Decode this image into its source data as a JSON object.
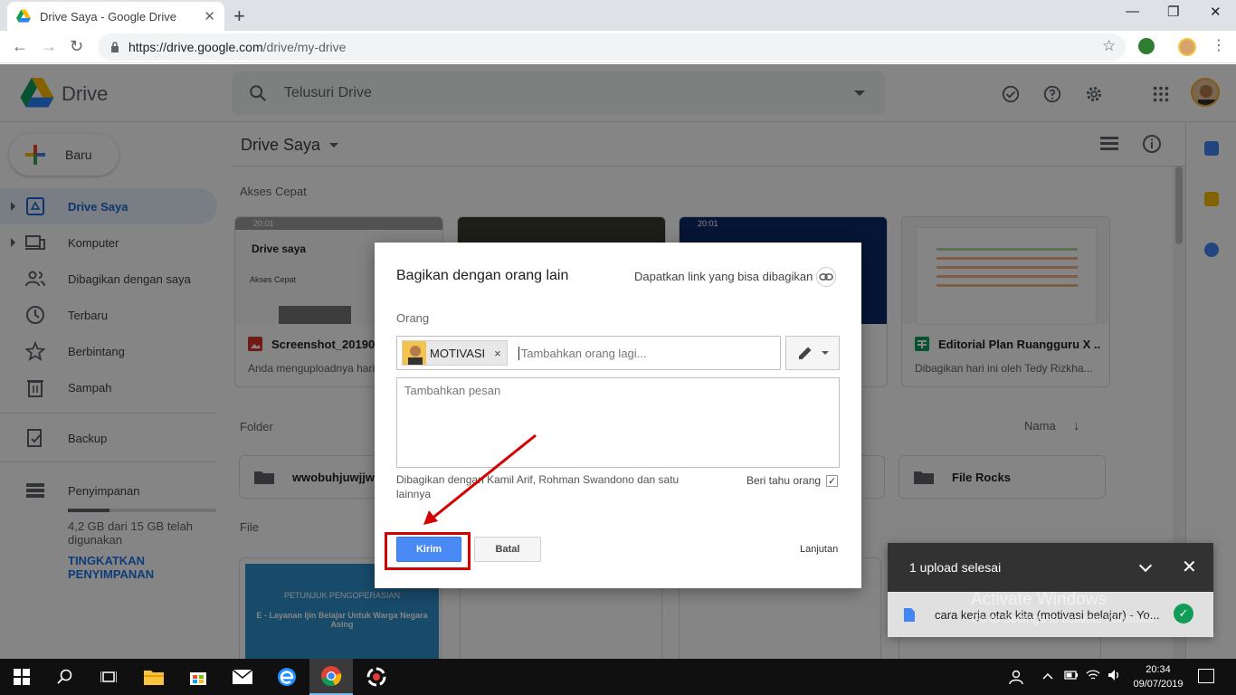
{
  "browser": {
    "tab_title": "Drive Saya - Google Drive",
    "tab_close": "✕",
    "new_tab": "+",
    "url_domain": "https://drive.google.com",
    "url_path": "/drive/my-drive",
    "win_minimize": "—",
    "win_restore": "❐",
    "win_close": "✕",
    "back": "←",
    "forward": "→",
    "reload": "↻",
    "bookmark_star": "☆",
    "menu": "⋮"
  },
  "drive": {
    "app_name": "Drive",
    "search_placeholder": "Telusuri Drive"
  },
  "sidebar": {
    "new_label": "Baru",
    "items": [
      {
        "label": "Drive Saya",
        "icon": "my-drive-icon"
      },
      {
        "label": "Komputer",
        "icon": "computer-icon"
      },
      {
        "label": "Dibagikan dengan saya",
        "icon": "shared-icon"
      },
      {
        "label": "Terbaru",
        "icon": "clock-icon"
      },
      {
        "label": "Berbintang",
        "icon": "star-icon"
      },
      {
        "label": "Sampah",
        "icon": "trash-icon"
      },
      {
        "label": "Backup",
        "icon": "backup-icon"
      },
      {
        "label": "Penyimpanan",
        "icon": "storage-icon"
      }
    ],
    "storage_text": "4,2 GB dari 15 GB telah digunakan",
    "storage_used_fraction": 0.28,
    "upgrade_label": "TINGKATKAN PENYIMPANAN"
  },
  "main": {
    "title": "Drive Saya",
    "quick_access_label": "Akses Cepat",
    "quick_cards": [
      {
        "name": "Screenshot_20190",
        "sub": "Anda menguploadnya hari",
        "thumb_text": "Drive saya",
        "thumb_sub": "Akses Cepat",
        "thumb_status": "20:01"
      },
      {
        "name": "",
        "sub": ""
      },
      {
        "name": "",
        "sub": "",
        "thumb_status": "20:01"
      },
      {
        "name": "Editorial Plan Ruangguru X ...",
        "sub": "Dibagikan hari ini oleh Tedy Rizkha..."
      }
    ],
    "folder_label": "Folder",
    "sort_label": "Nama",
    "folders": [
      {
        "name": "wwobuhjuwjjwik"
      },
      {
        "name": "File Rocks"
      }
    ],
    "file_label": "File",
    "file_thumb_title": "PETUNJUK PENGOPERASIAN",
    "file_thumb_sub": "E - Layanan Ijin Belajar Untuk Warga Negara Asing"
  },
  "dialog": {
    "title": "Bagikan dengan orang lain",
    "get_link": "Dapatkan link yang bisa dibagikan",
    "people_label": "Orang",
    "chip_name": "MOTIVASI",
    "chip_remove": "×",
    "people_placeholder": "Tambahkan orang lagi...",
    "message_placeholder": "Tambahkan pesan",
    "shared_with": "Dibagikan dengan Kamil Arif, Rohman Swandono dan satu lainnya",
    "notify_label": "Beri tahu orang",
    "notify_check": "✓",
    "send_label": "Kirim",
    "cancel_label": "Batal",
    "advanced_label": "Lanjutan"
  },
  "toast": {
    "title": "1 upload selesai",
    "close": "✕",
    "file_name": "cara kerja otak kita (motivasi belajar) - Yo...",
    "ok": "✓"
  },
  "watermark": {
    "line1": "Activate Windows",
    "line2": "Go to Settings to activate Windows."
  },
  "taskbar": {
    "time": "20:34",
    "date": "09/07/2019"
  },
  "colors": {
    "accent_blue": "#1a73e8",
    "send_button": "#4a8af4",
    "highlight_red": "#d50000",
    "success_green": "#0f9d58"
  }
}
